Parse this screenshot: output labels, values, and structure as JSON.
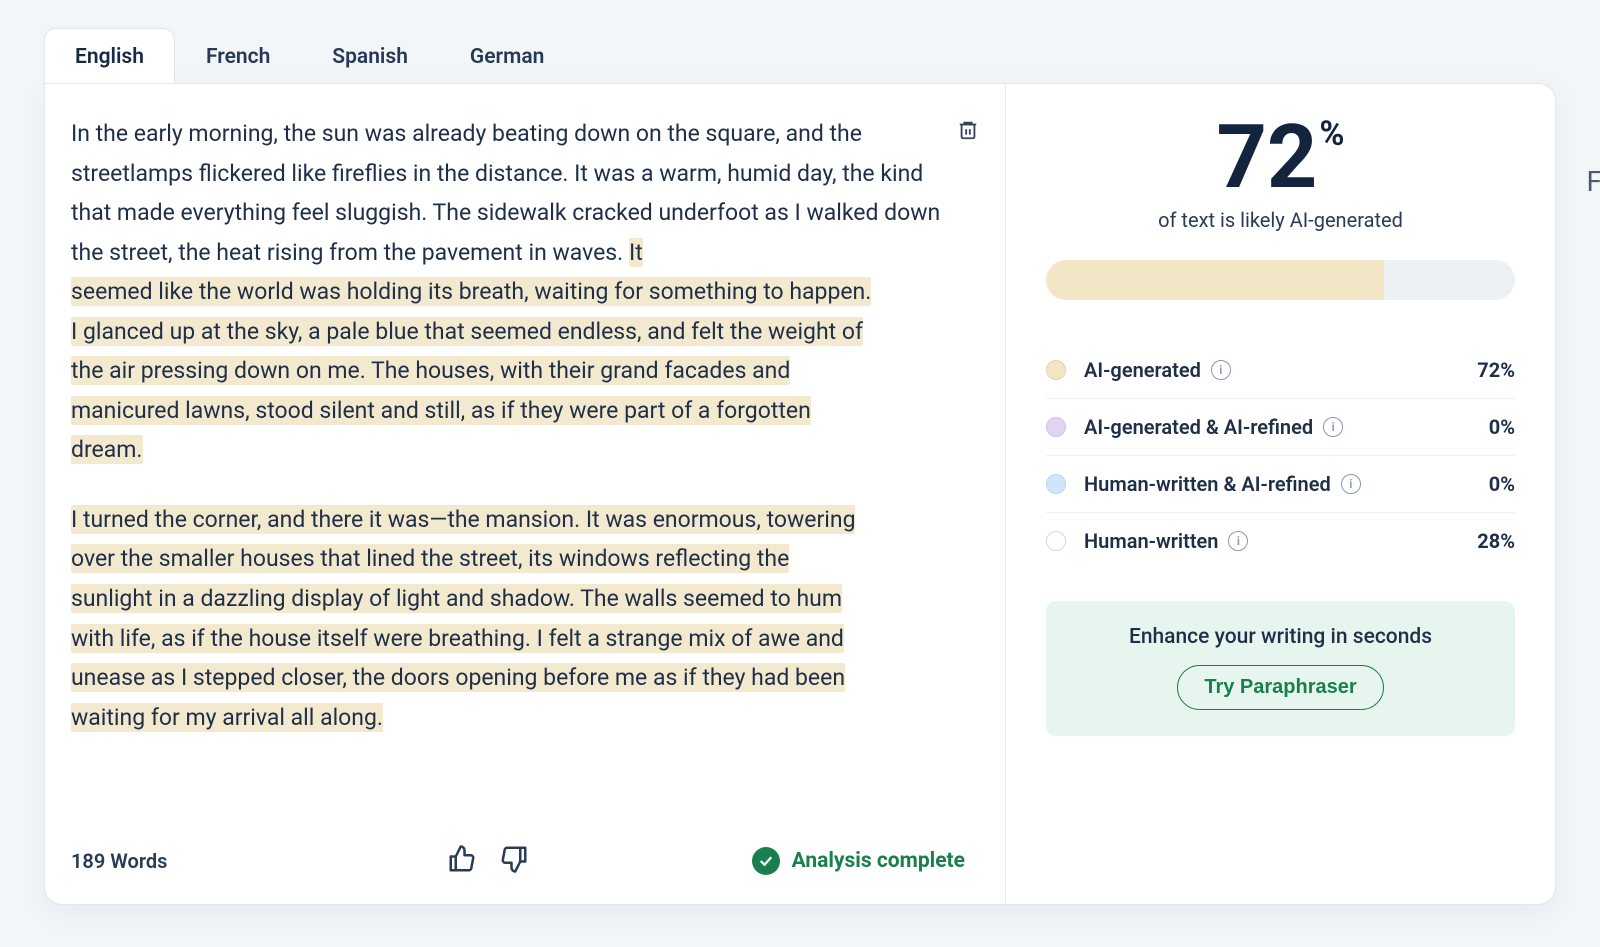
{
  "tabs": {
    "english": "English",
    "french": "French",
    "spanish": "Spanish",
    "german": "German",
    "active": "english"
  },
  "editor": {
    "p1_plain": "In the early morning, the sun was already beating down on the square, and the streetlamps flickered like fireflies in the distance. It was a warm, humid day, the kind that made everything feel sluggish. The sidewalk cracked underfoot as I walked down the street, the heat rising from the pavement in waves. ",
    "p1_hl1_lead": "It ",
    "p1_hl2": "seemed like the world was holding its breath, waiting for something to happen.",
    "p1_hl3": "I glanced up at the sky, a pale blue that seemed endless, and felt the weight of",
    "p1_hl4": "the air pressing down on me. The houses, with their grand facades and",
    "p1_hl5": "manicured lawns, stood silent and still, as if they were part of a forgotten",
    "p1_hl6": "dream.",
    "p2_l1": "I turned the corner, and there it was—the mansion. It was enormous, towering",
    "p2_l2": "over the smaller houses that lined the street, its windows reflecting the",
    "p2_l3": "sunlight in a dazzling display of light and shadow. The walls seemed to hum",
    "p2_l4": "with life, as if the house itself were breathing. I felt a strange mix of awe and",
    "p2_l5": "unease as I stepped closer, the doors opening before me as if they had been",
    "p2_l6": "waiting for my arrival all along."
  },
  "footer": {
    "wordcount": "189 Words",
    "status": "Analysis complete"
  },
  "result": {
    "score": "72",
    "pct": "%",
    "sub": "of text is likely AI-generated",
    "bar_pct": 72,
    "rows": [
      {
        "label": "AI-generated",
        "value": "72%",
        "dot": "d-tan"
      },
      {
        "label": "AI-generated & AI-refined",
        "value": "0%",
        "dot": "d-purple"
      },
      {
        "label": "Human-written & AI-refined",
        "value": "0%",
        "dot": "d-blue"
      },
      {
        "label": "Human-written",
        "value": "28%",
        "dot": "d-white"
      }
    ]
  },
  "cta": {
    "text": "Enhance your writing in seconds",
    "button": "Try Paraphraser"
  },
  "side": "F"
}
